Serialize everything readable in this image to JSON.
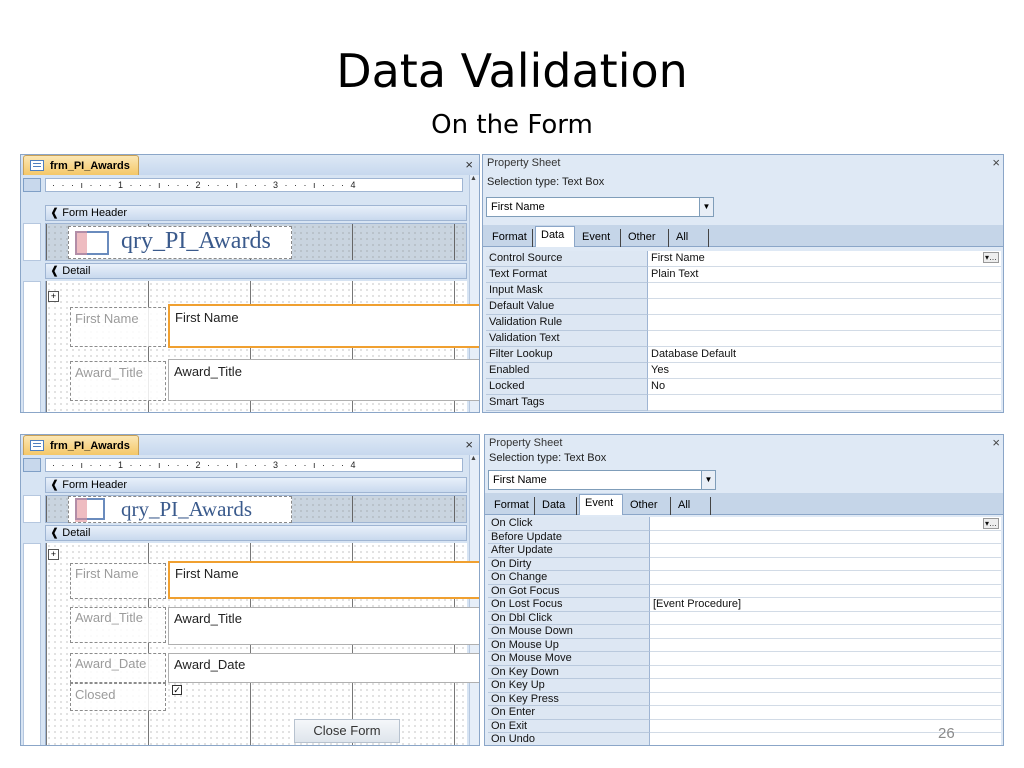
{
  "slide": {
    "title": "Data Validation",
    "subtitle": "On the Form",
    "page_number": "26"
  },
  "shot1": {
    "form": {
      "tab_label": "frm_PI_Awards",
      "close_glyph": "×",
      "ruler_text": "· · · ı · · · 1 · · · ı · · · 2 · · · ı · · · 3 · · · ı · · · 4",
      "form_header_label": "Form Header",
      "logo_text": "qry_PI_Awards",
      "detail_label": "Detail",
      "fields": [
        {
          "label": "First Name",
          "value": "First Name",
          "selected": true
        },
        {
          "label": "Award_Title",
          "value": "Award_Title",
          "selected": false
        }
      ]
    },
    "props": {
      "title": "Property Sheet",
      "close_glyph": "×",
      "selection_type": "Selection type:  Text Box",
      "combo_value": "First Name",
      "tabs": [
        "Format",
        "Data",
        "Event",
        "Other",
        "All"
      ],
      "active_tab": "Data",
      "rows": [
        {
          "name": "Control Source",
          "value": "First Name"
        },
        {
          "name": "Text Format",
          "value": "Plain Text"
        },
        {
          "name": "Input Mask",
          "value": ""
        },
        {
          "name": "Default Value",
          "value": ""
        },
        {
          "name": "Validation Rule",
          "value": ""
        },
        {
          "name": "Validation Text",
          "value": ""
        },
        {
          "name": "Filter Lookup",
          "value": "Database Default"
        },
        {
          "name": "Enabled",
          "value": "Yes"
        },
        {
          "name": "Locked",
          "value": "No"
        },
        {
          "name": "Smart Tags",
          "value": ""
        }
      ]
    }
  },
  "shot2": {
    "form": {
      "tab_label": "frm_PI_Awards",
      "close_glyph": "×",
      "ruler_text": "· · · ı · · · 1 · · · ı · · · 2 · · · ı · · · 3 · · · ı · · · 4",
      "form_header_label": "Form Header",
      "logo_text": "qry_PI_Awards",
      "detail_label": "Detail",
      "fields": [
        {
          "label": "First Name",
          "value": "First Name",
          "selected": true
        },
        {
          "label": "Award_Title",
          "value": "Award_Title",
          "selected": false
        },
        {
          "label": "Award_Date",
          "value": "Award_Date",
          "selected": false
        },
        {
          "label": "Closed",
          "value": "",
          "selected": false
        }
      ],
      "closed_checked": true,
      "close_button": "Close Form"
    },
    "props": {
      "title": "Property Sheet",
      "close_glyph": "×",
      "selection_type": "Selection type:  Text Box",
      "combo_value": "First Name",
      "tabs": [
        "Format",
        "Data",
        "Event",
        "Other",
        "All"
      ],
      "active_tab": "Event",
      "rows": [
        {
          "name": "On Click",
          "value": ""
        },
        {
          "name": "Before Update",
          "value": ""
        },
        {
          "name": "After Update",
          "value": ""
        },
        {
          "name": "On Dirty",
          "value": ""
        },
        {
          "name": "On Change",
          "value": ""
        },
        {
          "name": "On Got Focus",
          "value": ""
        },
        {
          "name": "On Lost Focus",
          "value": "[Event Procedure]"
        },
        {
          "name": "On Dbl Click",
          "value": ""
        },
        {
          "name": "On Mouse Down",
          "value": ""
        },
        {
          "name": "On Mouse Up",
          "value": ""
        },
        {
          "name": "On Mouse Move",
          "value": ""
        },
        {
          "name": "On Key Down",
          "value": ""
        },
        {
          "name": "On Key Up",
          "value": ""
        },
        {
          "name": "On Key Press",
          "value": ""
        },
        {
          "name": "On Enter",
          "value": ""
        },
        {
          "name": "On Exit",
          "value": ""
        },
        {
          "name": "On Undo",
          "value": ""
        }
      ]
    }
  }
}
